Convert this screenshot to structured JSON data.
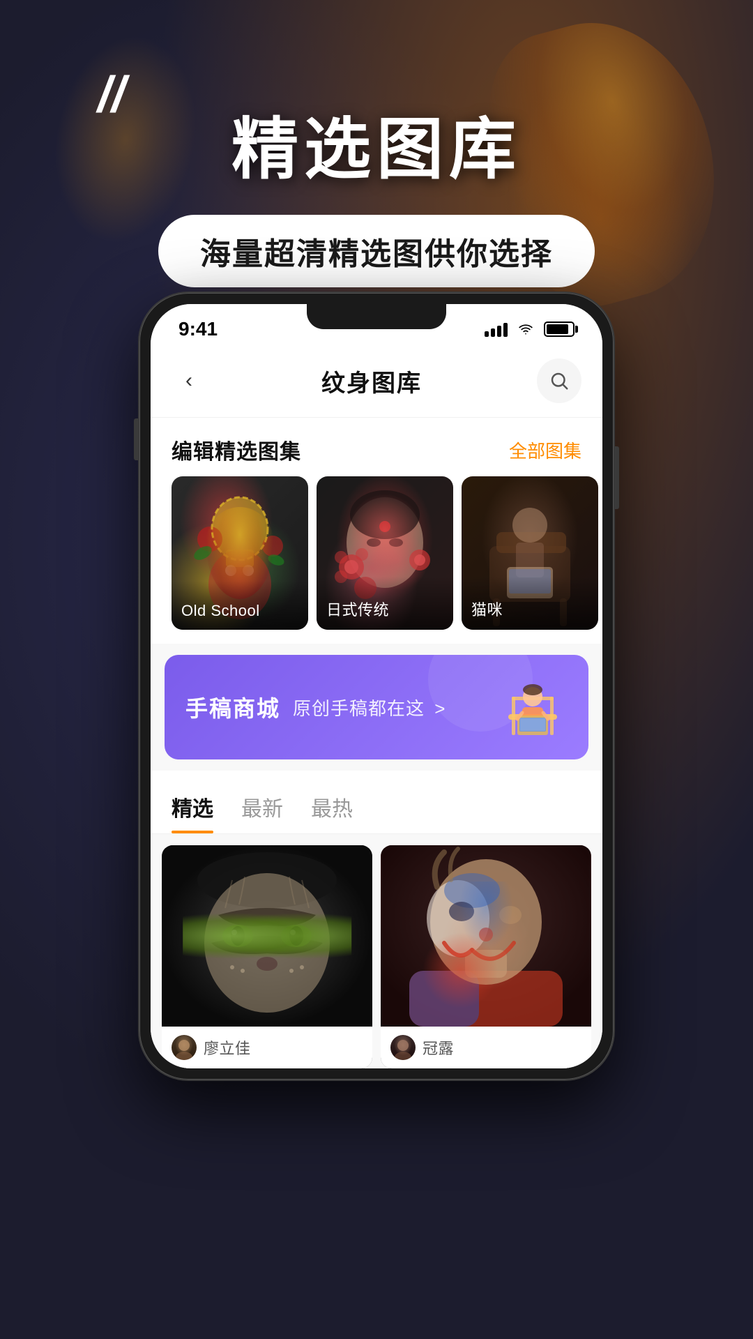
{
  "background": {
    "color": "#1c1c2e"
  },
  "promo": {
    "quote_marks": "//",
    "title": "精选图库",
    "subtitle": "海量超清精选图供你选择"
  },
  "status_bar": {
    "time": "9:41",
    "signal_label": "signal",
    "wifi_label": "wifi",
    "battery_label": "battery"
  },
  "nav": {
    "back_label": "‹",
    "title": "纹身图库",
    "search_label": "search"
  },
  "editor_section": {
    "title": "编辑精选图集",
    "all_link": "全部图集",
    "cards": [
      {
        "id": "old-school",
        "label": "Old School",
        "style": "oldschool"
      },
      {
        "id": "japanese",
        "label": "日式传统",
        "style": "japanese"
      },
      {
        "id": "cat",
        "label": "猫咪",
        "style": "cat"
      }
    ]
  },
  "banner": {
    "title": "手稿商城",
    "subtitle": "原创手稿都在这",
    "arrow": ">",
    "illustration": "person-laptop"
  },
  "tabs": [
    {
      "id": "featured",
      "label": "精选",
      "active": true
    },
    {
      "id": "latest",
      "label": "最新",
      "active": false
    },
    {
      "id": "hottest",
      "label": "最热",
      "active": false
    }
  ],
  "grid": {
    "items": [
      {
        "id": "tiger",
        "style": "tiger",
        "author_avatar": "avatar1",
        "author_name": "廖立佳"
      },
      {
        "id": "joker",
        "style": "joker",
        "author_avatar": "avatar2",
        "author_name": "冠露"
      }
    ]
  }
}
